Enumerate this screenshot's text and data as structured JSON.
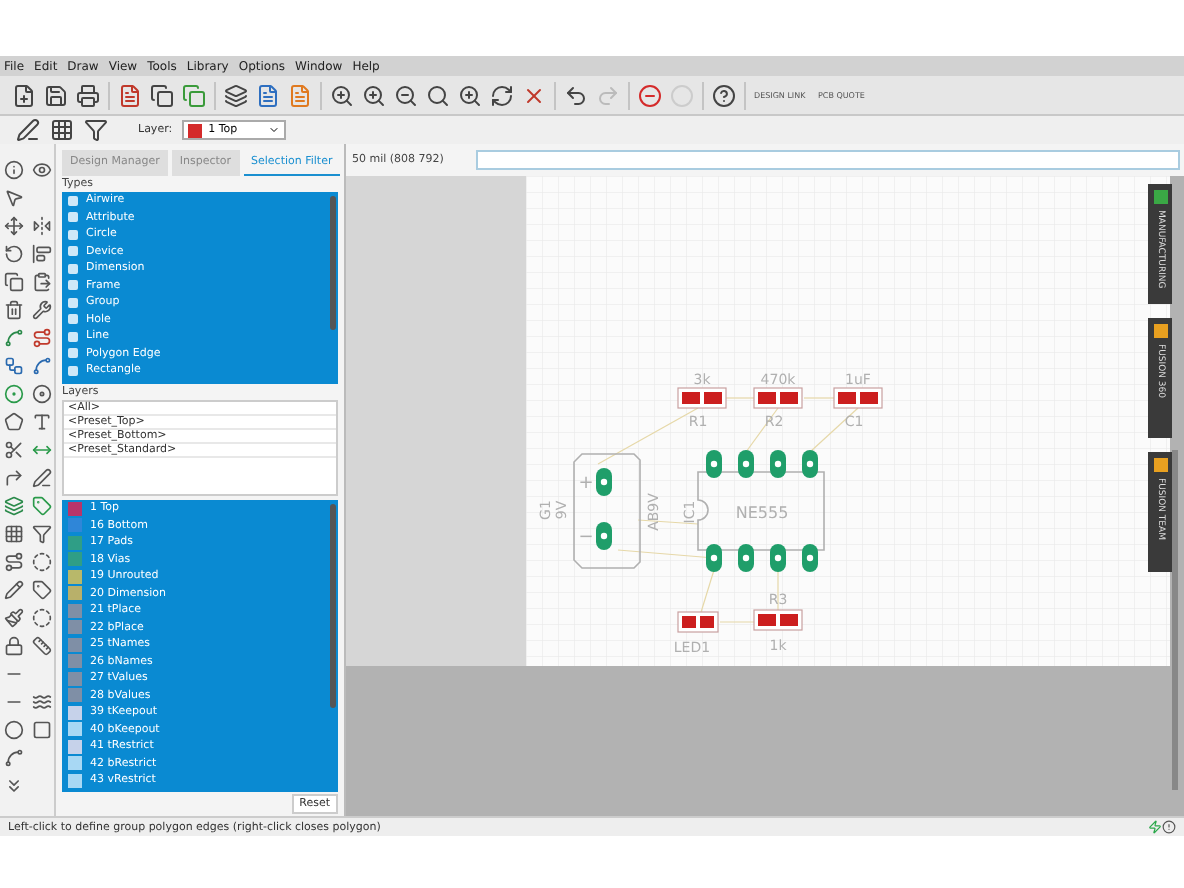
{
  "menu": [
    "File",
    "Edit",
    "Draw",
    "View",
    "Tools",
    "Library",
    "Options",
    "Window",
    "Help"
  ],
  "toolbar": {
    "design_link": "DESIGN LINK",
    "pcb_quote": "PCB QUOTE"
  },
  "layer_bar": {
    "label": "Layer:",
    "value": "1 Top"
  },
  "panel": {
    "tabs": [
      {
        "label": "Design Manager",
        "selected": false
      },
      {
        "label": "Inspector",
        "selected": false
      },
      {
        "label": "Selection Filter",
        "selected": true
      }
    ],
    "types_header": "Types",
    "types": [
      {
        "label": "Airwire",
        "selected": true
      },
      {
        "label": "Attribute",
        "selected": true
      },
      {
        "label": "Circle",
        "selected": true
      },
      {
        "label": "Device",
        "selected": true
      },
      {
        "label": "Dimension",
        "selected": true
      },
      {
        "label": "Frame",
        "selected": true
      },
      {
        "label": "Group",
        "selected": true
      },
      {
        "label": "Hole",
        "selected": true
      },
      {
        "label": "Line",
        "selected": true
      },
      {
        "label": "Polygon Edge",
        "selected": true
      },
      {
        "label": "Rectangle",
        "selected": true
      }
    ],
    "layers_header": "Layers",
    "presets": [
      "<All>",
      "<Preset_Top>",
      "<Preset_Bottom>",
      "<Preset_Standard>"
    ],
    "layers": [
      {
        "label": "1 Top",
        "color": "#b8356a",
        "selected": true
      },
      {
        "label": "16 Bottom",
        "color": "#2f86d8",
        "selected": true
      },
      {
        "label": "17 Pads",
        "color": "#2f9e86",
        "selected": true
      },
      {
        "label": "18 Vias",
        "color": "#2f9e86",
        "selected": true
      },
      {
        "label": "19 Unrouted",
        "color": "#b8b86a",
        "selected": true
      },
      {
        "label": "20 Dimension",
        "color": "#b8b06a",
        "selected": true
      },
      {
        "label": "21 tPlace",
        "color": "#7f8fa6",
        "selected": true
      },
      {
        "label": "22 bPlace",
        "color": "#7f8fa6",
        "selected": true
      },
      {
        "label": "25 tNames",
        "color": "#7f8fa6",
        "selected": true
      },
      {
        "label": "26 bNames",
        "color": "#7f8fa6",
        "selected": true
      },
      {
        "label": "27 tValues",
        "color": "#7f8fa6",
        "selected": true
      },
      {
        "label": "28 bValues",
        "color": "#7f8fa6",
        "selected": true
      },
      {
        "label": "39 tKeepout",
        "color": "#c6d2ea",
        "selected": true
      },
      {
        "label": "40 bKeepout",
        "color": "#a8d8f4",
        "selected": true
      },
      {
        "label": "41 tRestrict",
        "color": "#c6d2ea",
        "selected": true
      },
      {
        "label": "42 bRestrict",
        "color": "#a8d8f4",
        "selected": true
      },
      {
        "label": "43 vRestrict",
        "color": "#a8d8f4",
        "selected": true
      }
    ],
    "reset": "Reset"
  },
  "coordinate": "50 mil (808 792)",
  "pcb": {
    "parts": [
      {
        "kind": "resistor",
        "name": "R1",
        "value": "3k"
      },
      {
        "kind": "resistor",
        "name": "R2",
        "value": "470k"
      },
      {
        "kind": "capacitor",
        "name": "C1",
        "value": "1uF"
      },
      {
        "kind": "battery",
        "name": "G1",
        "value": "9V",
        "package": "AB9V",
        "plus": "+",
        "minus": "−"
      },
      {
        "kind": "ic",
        "name": "IC1",
        "value": "NE555"
      },
      {
        "kind": "led",
        "name": "LED1"
      },
      {
        "kind": "resistor",
        "name": "R3",
        "value": "1k"
      }
    ]
  },
  "side_tabs": [
    {
      "label": "MANUFACTURING",
      "color": "#3aa845"
    },
    {
      "label": "FUSION 360",
      "color": "#e8a020"
    },
    {
      "label": "FUSION TEAM",
      "color": "#e8a020"
    }
  ],
  "status_bar": "Left-click to define group polygon edges (right-click closes polygon)"
}
